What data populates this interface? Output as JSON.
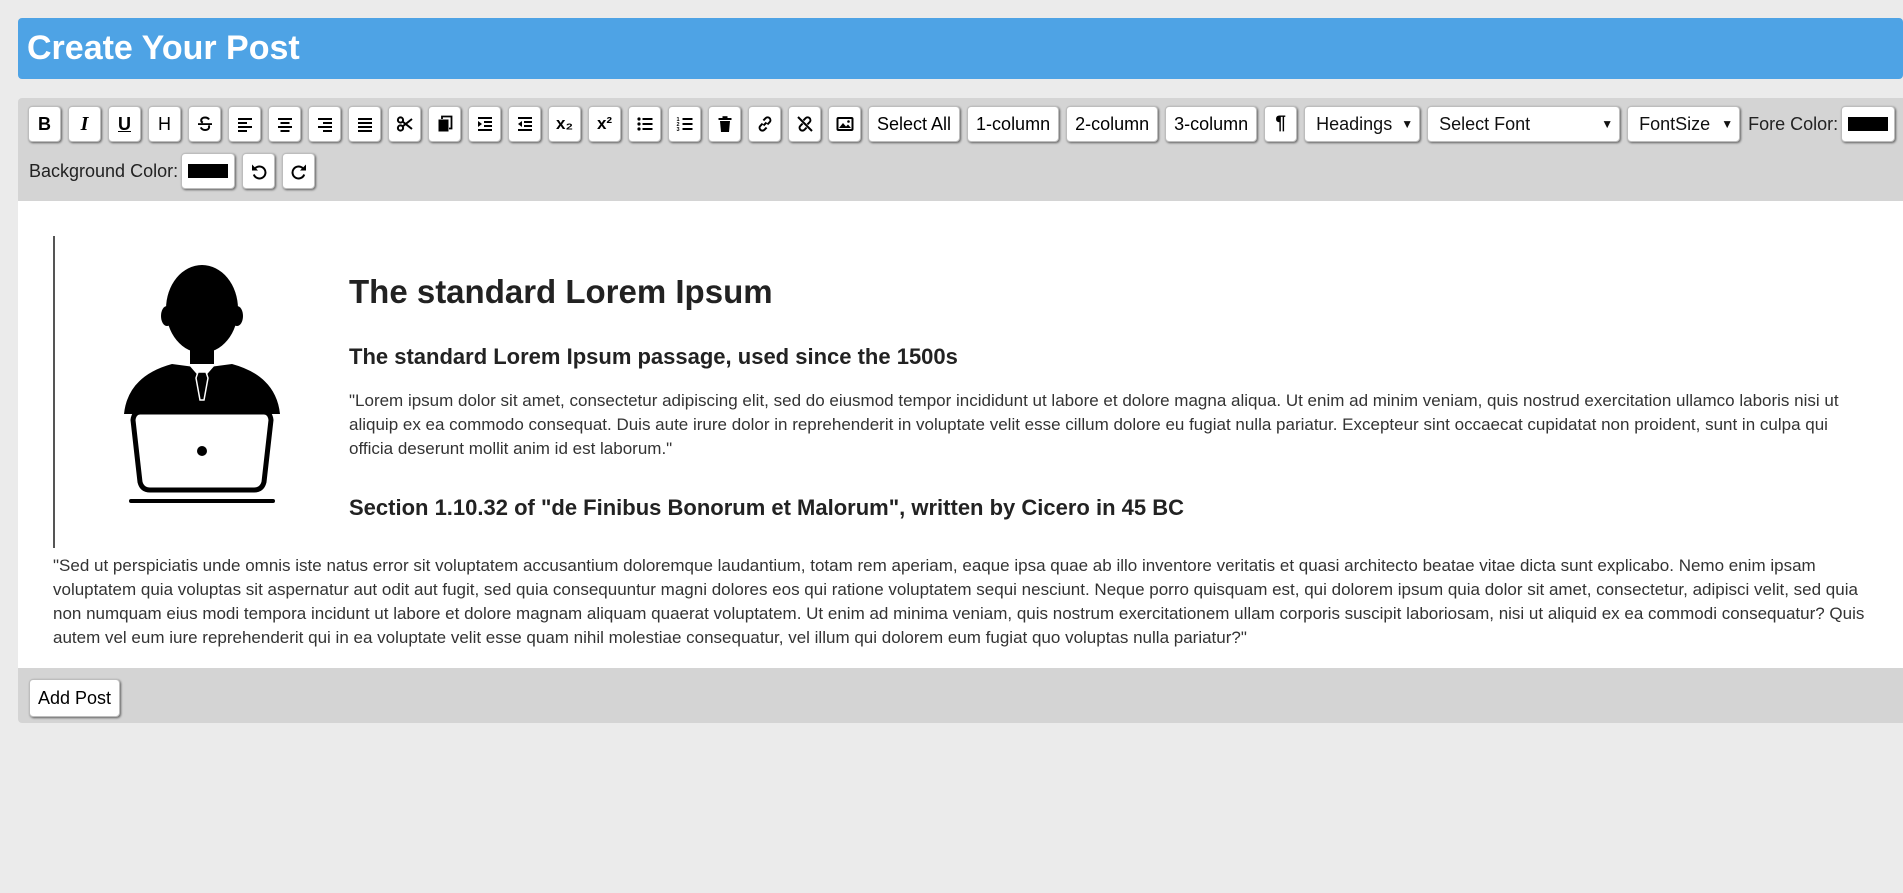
{
  "header": {
    "title": "Create Your Post"
  },
  "toolbar": {
    "bold_label": "B",
    "italic_label": "I",
    "underline_label": "U",
    "heading_label": "H",
    "subscript_label": "x₂",
    "superscript_label": "x²",
    "select_all_label": "Select All",
    "one_column_label": "1-column",
    "two_column_label": "2-column",
    "three_column_label": "3-column",
    "paragraph_label": "¶",
    "headings_select": "Headings",
    "font_select": "Select Font",
    "fontsize_select": "FontSize",
    "fore_color_label": "Fore Color:",
    "fore_color_value": "#000000",
    "background_color_label": "Background Color:",
    "background_color_value": "#000000",
    "accent_color": "#4ea3e5"
  },
  "icons": [
    "strikethrough-icon",
    "align-left-icon",
    "align-center-icon",
    "align-right-icon",
    "align-justify-icon",
    "cut-icon",
    "copy-icon",
    "indent-icon",
    "outdent-icon",
    "unordered-list-icon",
    "ordered-list-icon",
    "trash-icon",
    "link-icon",
    "unlink-icon",
    "image-icon",
    "undo-icon",
    "redo-icon",
    "user-laptop-icon"
  ],
  "content": {
    "title": "The standard Lorem Ipsum",
    "subtitle": "The standard Lorem Ipsum passage, used since the 1500s",
    "paragraph1": "\"Lorem ipsum dolor sit amet, consectetur adipiscing elit, sed do eiusmod tempor incididunt ut labore et dolore magna aliqua. Ut enim ad minim veniam, quis nostrud exercitation ullamco laboris nisi ut aliquip ex ea commodo consequat. Duis aute irure dolor in reprehenderit in voluptate velit esse cillum dolore eu fugiat nulla pariatur. Excepteur sint occaecat cupidatat non proident, sunt in culpa qui officia deserunt mollit anim id est laborum.\"",
    "section_heading": "Section 1.10.32 of \"de Finibus Bonorum et Malorum\", written by Cicero in 45 BC",
    "paragraph2": "\"Sed ut perspiciatis unde omnis iste natus error sit voluptatem accusantium doloremque laudantium, totam rem aperiam, eaque ipsa quae ab illo inventore veritatis et quasi architecto beatae vitae dicta sunt explicabo. Nemo enim ipsam voluptatem quia voluptas sit aspernatur aut odit aut fugit, sed quia consequuntur magni dolores eos qui ratione voluptatem sequi nesciunt. Neque porro quisquam est, qui dolorem ipsum quia dolor sit amet, consectetur, adipisci velit, sed quia non numquam eius modi tempora incidunt ut labore et dolore magnam aliquam quaerat voluptatem. Ut enim ad minima veniam, quis nostrum exercitationem ullam corporis suscipit laboriosam, nisi ut aliquid ex ea commodi consequatur? Quis autem vel eum iure reprehenderit qui in ea voluptate velit esse quam nihil molestiae consequatur, vel illum qui dolorem eum fugiat quo voluptas nulla pariatur?\""
  },
  "footer": {
    "add_post_label": "Add Post"
  }
}
